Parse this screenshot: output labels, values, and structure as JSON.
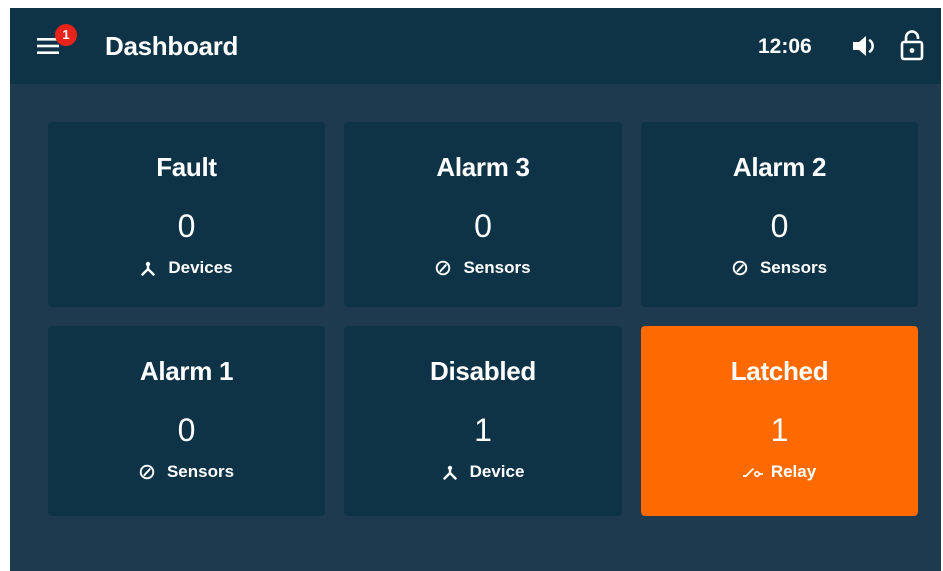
{
  "header": {
    "title": "Dashboard",
    "time": "12:06",
    "notification_count": "1"
  },
  "icons": {
    "menu": "menu-icon",
    "volume": "volume-icon",
    "lock": "lock-open-icon",
    "device": "device-icon",
    "sensor": "sensor-gauge-icon",
    "relay": "relay-switch-icon"
  },
  "colors": {
    "header_bg": "#0e3347",
    "background": "#1d3a4e",
    "tile_bg": "#0e3347",
    "latched_bg": "#ff6a00",
    "badge": "#e8231a",
    "text": "#ffffff"
  },
  "tiles": [
    {
      "title": "Fault",
      "value": "0",
      "label": "Devices",
      "icon": "device-icon"
    },
    {
      "title": "Alarm 3",
      "value": "0",
      "label": "Sensors",
      "icon": "sensor-gauge-icon"
    },
    {
      "title": "Alarm 2",
      "value": "0",
      "label": "Sensors",
      "icon": "sensor-gauge-icon"
    },
    {
      "title": "Alarm 1",
      "value": "0",
      "label": "Sensors",
      "icon": "sensor-gauge-icon"
    },
    {
      "title": "Disabled",
      "value": "1",
      "label": "Device",
      "icon": "device-icon"
    },
    {
      "title": "Latched",
      "value": "1",
      "label": "Relay",
      "icon": "relay-switch-icon",
      "highlighted": true
    }
  ]
}
